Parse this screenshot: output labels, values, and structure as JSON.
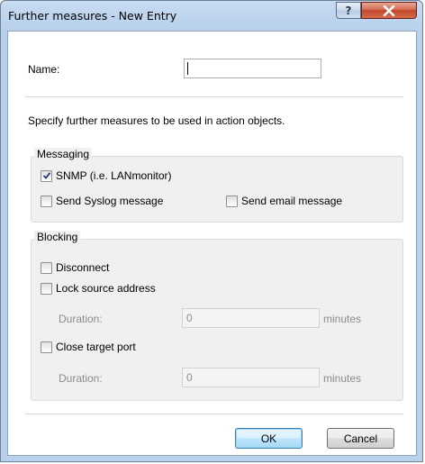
{
  "window": {
    "title": "Further measures - New Entry",
    "help_symbol": "?"
  },
  "form": {
    "name_label": "Name:",
    "name_value": "",
    "description": "Specify further measures to be used in action objects."
  },
  "messaging": {
    "title": "Messaging",
    "snmp": {
      "label": "SNMP (i.e. LANmonitor)",
      "checked": true
    },
    "syslog": {
      "label": "Send Syslog message",
      "checked": false
    },
    "email": {
      "label": "Send email message",
      "checked": false
    }
  },
  "blocking": {
    "title": "Blocking",
    "disconnect": {
      "label": "Disconnect",
      "checked": false
    },
    "lock_source": {
      "label": "Lock source address",
      "checked": false
    },
    "lock_duration": {
      "label": "Duration:",
      "value": "0",
      "unit": "minutes"
    },
    "close_port": {
      "label": "Close target port",
      "checked": false
    },
    "port_duration": {
      "label": "Duration:",
      "value": "0",
      "unit": "minutes"
    }
  },
  "buttons": {
    "ok": "OK",
    "cancel": "Cancel"
  },
  "colors": {
    "title_bar": "#b9d1ec",
    "close_button": "#c1452a",
    "group_background": "#f0f0f0"
  }
}
